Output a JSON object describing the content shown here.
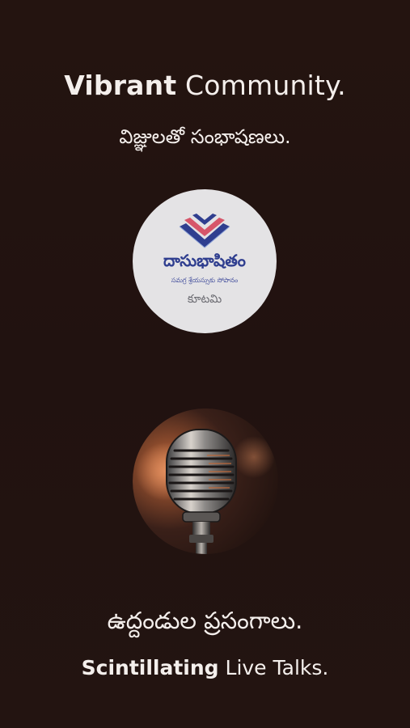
{
  "headline": {
    "bold": "Vibrant",
    "rest": " Community."
  },
  "subheadline_telugu": "విజ్ఞులతో సంభాషణలు.",
  "logo": {
    "name": "దాసుభాషితం",
    "tagline": "సమగ్ర శ్రేయస్సుకు సోపానం",
    "subtitle": "కూటమి",
    "icon": "book-chevron-logo-icon",
    "colors": {
      "primary": "#2f3e8f",
      "accent": "#d6566a",
      "background": "#e4e3e5"
    }
  },
  "microphone_image": {
    "icon": "microphone-icon"
  },
  "talks_telugu": "ఉద్దండుల ప్రసంగాలు.",
  "talks_english": {
    "bold": "Scintillating",
    "rest": " Live Talks."
  },
  "colors": {
    "background": "#221310",
    "text": "#f4efec"
  }
}
